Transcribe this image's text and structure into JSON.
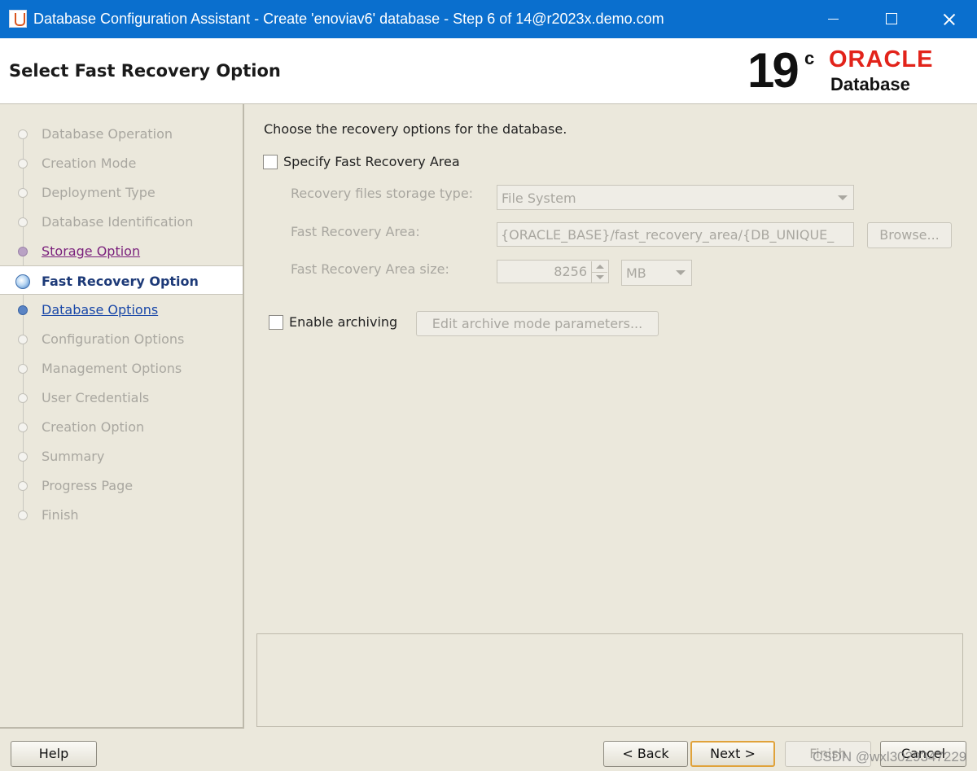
{
  "window": {
    "title": "Database Configuration Assistant - Create 'enoviav6' database - Step 6 of 14@r2023x.demo.com"
  },
  "header": {
    "page_title": "Select Fast Recovery Option",
    "logo": {
      "version": "19",
      "superscript": "c",
      "brand": "ORACLE",
      "product": "Database"
    }
  },
  "steps": [
    {
      "label": "Database Operation",
      "state": "done"
    },
    {
      "label": "Creation Mode",
      "state": "done"
    },
    {
      "label": "Deployment Type",
      "state": "done"
    },
    {
      "label": "Database Identification",
      "state": "done"
    },
    {
      "label": "Storage Option",
      "state": "visited"
    },
    {
      "label": "Fast Recovery Option",
      "state": "current"
    },
    {
      "label": "Database Options",
      "state": "link"
    },
    {
      "label": "Configuration Options",
      "state": "pending"
    },
    {
      "label": "Management Options",
      "state": "pending"
    },
    {
      "label": "User Credentials",
      "state": "pending"
    },
    {
      "label": "Creation Option",
      "state": "pending"
    },
    {
      "label": "Summary",
      "state": "pending"
    },
    {
      "label": "Progress Page",
      "state": "pending"
    },
    {
      "label": "Finish",
      "state": "pending"
    }
  ],
  "main": {
    "intro": "Choose the recovery options for the database.",
    "specify_fra": {
      "label": "Specify Fast Recovery Area",
      "checked": false
    },
    "storage_type": {
      "label": "Recovery files storage type:",
      "value": "File System"
    },
    "fra_location": {
      "label": "Fast Recovery Area:",
      "value": "{ORACLE_BASE}/fast_recovery_area/{DB_UNIQUE_",
      "browse": "Browse..."
    },
    "fra_size": {
      "label": "Fast Recovery Area size:",
      "value": "8256",
      "unit": "MB"
    },
    "archiving": {
      "label": "Enable archiving",
      "checked": false,
      "edit_button": "Edit archive mode parameters..."
    }
  },
  "footer": {
    "help": "Help",
    "back": "< Back",
    "next": "Next >",
    "finish": "Finish",
    "cancel": "Cancel"
  },
  "watermark": "CSDN @wxl3029347229",
  "colors": {
    "titlebar": "#0a6fce",
    "oracle_red": "#e2231a",
    "visited_link": "#7a1f7c",
    "link": "#1a48a8",
    "panel": "#ebe8dc"
  }
}
